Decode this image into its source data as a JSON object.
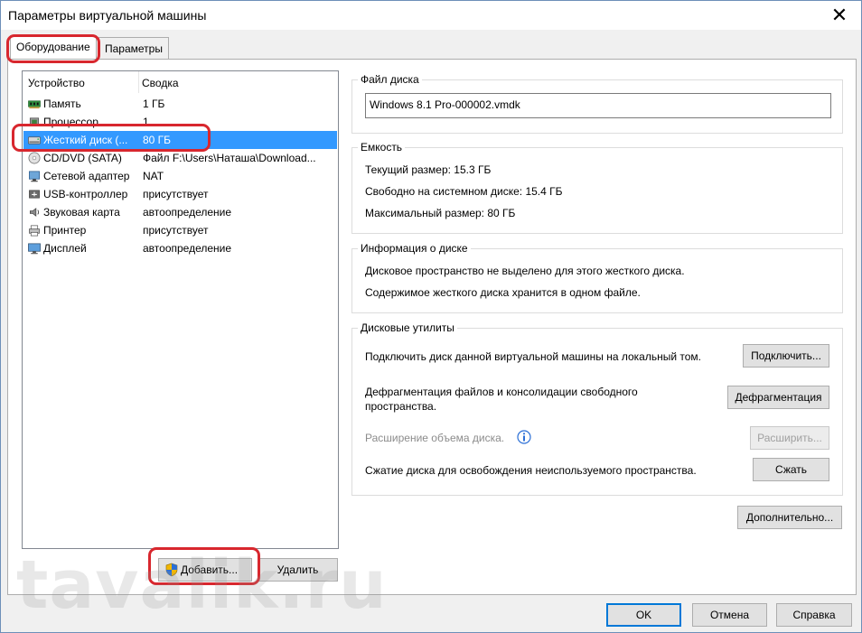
{
  "window": {
    "title": "Параметры виртуальной машины"
  },
  "tabs": [
    {
      "label": "Оборудование"
    },
    {
      "label": "Параметры"
    }
  ],
  "device_list": {
    "headers": {
      "device": "Устройство",
      "summary": "Сводка"
    },
    "rows": [
      {
        "name": "Память",
        "summary": "1 ГБ",
        "icon": "memory-icon"
      },
      {
        "name": "Процессор",
        "summary": "1",
        "icon": "processor-icon"
      },
      {
        "name": "Жесткий диск (...",
        "summary": "80 ГБ",
        "icon": "hard-disk-icon",
        "selected": true
      },
      {
        "name": "CD/DVD (SATA)",
        "summary": "Файл F:\\Users\\Наташа\\Download...",
        "icon": "cd-dvd-icon"
      },
      {
        "name": "Сетевой адаптер",
        "summary": "NAT",
        "icon": "network-adapter-icon"
      },
      {
        "name": "USB-контроллер",
        "summary": "присутствует",
        "icon": "usb-icon"
      },
      {
        "name": "Звуковая карта",
        "summary": "автоопределение",
        "icon": "sound-card-icon"
      },
      {
        "name": "Принтер",
        "summary": "присутствует",
        "icon": "printer-icon"
      },
      {
        "name": "Дисплей",
        "summary": "автоопределение",
        "icon": "display-icon"
      }
    ]
  },
  "buttons": {
    "add": "Добавить...",
    "remove": "Удалить",
    "advanced": "Дополнительно...",
    "ok": "OK",
    "cancel": "Отмена",
    "help": "Справка"
  },
  "disk_file": {
    "label": "Файл диска",
    "value": "Windows 8.1 Pro-000002.vmdk"
  },
  "capacity": {
    "label": "Емкость",
    "current": "Текущий размер: 15.3 ГБ",
    "free": "Свободно на системном диске: 15.4 ГБ",
    "max": "Максимальный размер: 80 ГБ"
  },
  "disk_info": {
    "label": "Информация о диске",
    "line1": "Дисковое пространство не выделено для этого жесткого диска.",
    "line2": "Содержимое жесткого диска хранится в одном файле."
  },
  "disk_utils": {
    "label": "Дисковые утилиты",
    "map_text": "Подключить диск данной виртуальной машины на локальный том.",
    "map_button": "Подключить...",
    "defrag_text_1": "Дефрагментация файлов и консолидации свободного",
    "defrag_text_2": "пространства.",
    "defrag_button": "Дефрагментация",
    "expand_text": "Расширение объема диска.",
    "expand_button": "Расширить...",
    "compact_text": "Сжатие диска для освобождения неиспользуемого пространства.",
    "compact_button": "Сжать"
  },
  "watermark": "tavalik.ru",
  "colors": {
    "selection": "#3399ff",
    "highlight": "#d8272e",
    "primary_border": "#0078d7"
  }
}
